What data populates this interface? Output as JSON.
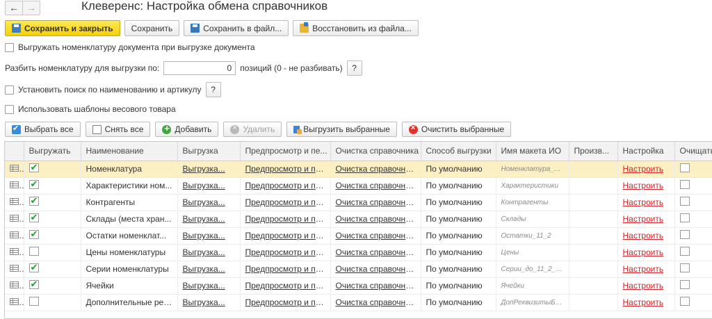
{
  "window": {
    "title": "Клеверенс: Настройка обмена справочников",
    "back": "←",
    "forward": "→"
  },
  "commands": {
    "save_close": "Сохранить и закрыть",
    "save": "Сохранить",
    "save_file": "Сохранить в файл...",
    "restore_file": "Восстановить из файла..."
  },
  "options": {
    "export_nomenclature": {
      "label": "Выгружать номенклатуру документа при выгрузке документа",
      "checked": false
    },
    "split": {
      "label": "Разбить номенклатуру для выгрузки по:",
      "value": "0",
      "suffix": "позиций (0 - не разбивать)",
      "help": "?"
    },
    "search": {
      "label": "Установить поиск по наименованию и артикулу",
      "checked": false,
      "help": "?"
    },
    "weight_templates": {
      "label": "Использовать шаблоны весового товара",
      "checked": false
    }
  },
  "toolbar": {
    "select_all": "Выбрать все",
    "deselect_all": "Снять все",
    "add": "Добавить",
    "delete": "Удалить",
    "export_selected": "Выгрузить выбранные",
    "clear_selected": "Очистить выбранные"
  },
  "table": {
    "columns": [
      "",
      "Выгружать",
      "Наименование",
      "Выгрузка",
      "Предпросмотр и пе...",
      "Очистка справочника",
      "Способ выгрузки",
      "Имя макета ИО",
      "Произв...",
      "Настройка",
      "Очищать"
    ],
    "rows": [
      {
        "checked": true,
        "name": "Номенклатура",
        "export": "Выгрузка...",
        "preview": "Предпросмотр и пе...",
        "clear": "Очистка справочни...",
        "method": "По умолчанию",
        "layout": "Номенклатура_Б...",
        "prod": "",
        "setup": "Настроить",
        "clean": false
      },
      {
        "checked": true,
        "name": "Характеристики ном...",
        "export": "Выгрузка...",
        "preview": "Предпросмотр и пе...",
        "clear": "Очистка справочни...",
        "method": "По умолчанию",
        "layout": "Характеристики",
        "prod": "",
        "setup": "Настроить",
        "clean": false
      },
      {
        "checked": true,
        "name": "Контрагенты",
        "export": "Выгрузка...",
        "preview": "Предпросмотр и пе...",
        "clear": "Очистка справочни...",
        "method": "По умолчанию",
        "layout": "Контрагенты",
        "prod": "",
        "setup": "Настроить",
        "clean": false
      },
      {
        "checked": true,
        "name": "Склады (места хран...",
        "export": "Выгрузка...",
        "preview": "Предпросмотр и пе...",
        "clear": "Очистка справочни...",
        "method": "По умолчанию",
        "layout": "Склады",
        "prod": "",
        "setup": "Настроить",
        "clean": false
      },
      {
        "checked": true,
        "name": "Остатки номенклат...",
        "export": "Выгрузка...",
        "preview": "Предпросмотр и пе...",
        "clear": "Очистка справочни...",
        "method": "По умолчанию",
        "layout": "Остатки_11_2",
        "prod": "",
        "setup": "Настроить",
        "clean": false
      },
      {
        "checked": false,
        "name": "Цены номенклатуры",
        "export": "Выгрузка...",
        "preview": "Предпросмотр и пе...",
        "clear": "Очистка справочни...",
        "method": "По умолчанию",
        "layout": "Цены",
        "prod": "",
        "setup": "Настроить",
        "clean": false
      },
      {
        "checked": true,
        "name": "Серии номенклатуры",
        "export": "Выгрузка...",
        "preview": "Предпросмотр и пе...",
        "clear": "Очистка справочни...",
        "method": "По умолчанию",
        "layout": "Серии_до_11_2_3...",
        "prod": "",
        "setup": "Настроить",
        "clean": false
      },
      {
        "checked": true,
        "name": "Ячейки",
        "export": "Выгрузка...",
        "preview": "Предпросмотр и пе...",
        "clear": "Очистка справочни...",
        "method": "По умолчанию",
        "layout": "Ячейки",
        "prod": "",
        "setup": "Настроить",
        "clean": false
      },
      {
        "checked": false,
        "name": "Дополнительные рек...",
        "export": "Выгрузка...",
        "preview": "Предпросмотр и пе...",
        "clear": "Очистка справочни...",
        "method": "По умолчанию",
        "layout": "ДопРеквизитыБе...",
        "prod": "",
        "setup": "Настроить",
        "clean": false
      }
    ]
  },
  "colors": {
    "primary_button": "#f5d008",
    "selected_row": "#fbefc4",
    "link_red": "#d8232a",
    "check_green": "#16a52c"
  }
}
